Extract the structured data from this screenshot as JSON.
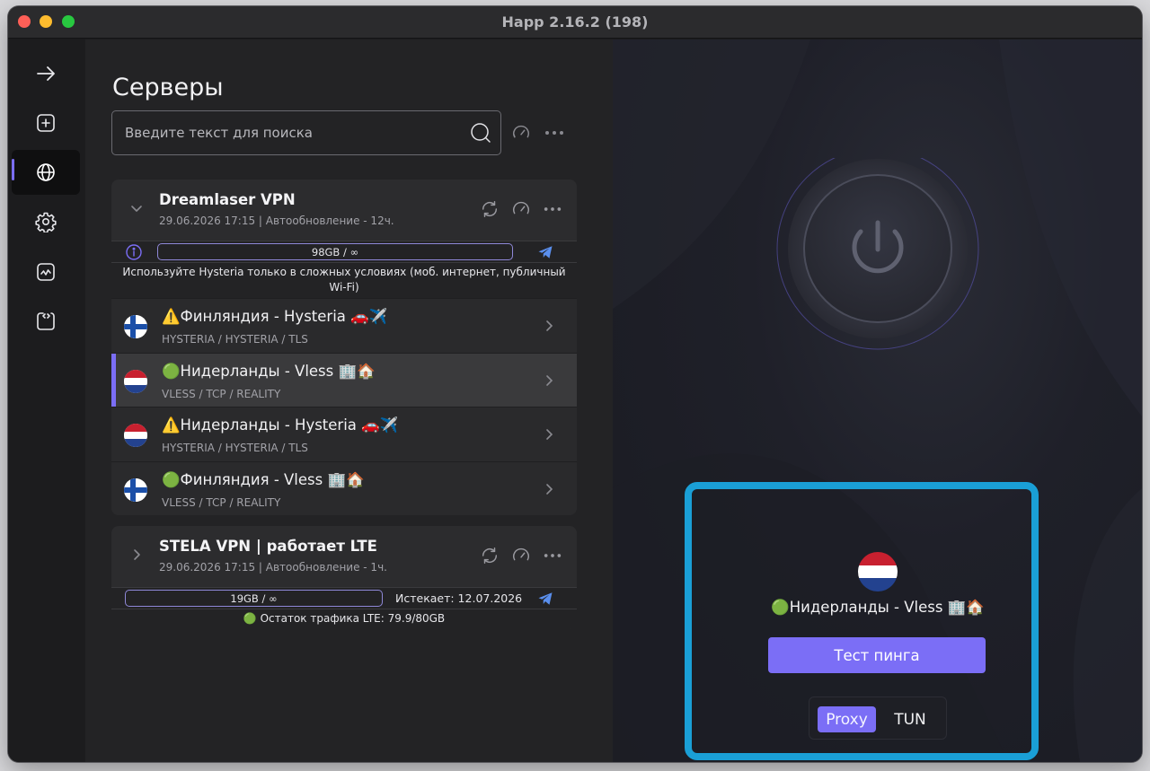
{
  "window": {
    "title": "Happ 2.16.2 (198)"
  },
  "sidebar": {
    "items": [
      {
        "name": "arrow-right-icon"
      },
      {
        "name": "add-square-icon"
      },
      {
        "name": "globe-icon",
        "active": true
      },
      {
        "name": "gear-icon"
      },
      {
        "name": "activity-chart-icon"
      },
      {
        "name": "code-bracket-icon"
      }
    ],
    "info_label": "i"
  },
  "servers": {
    "title": "Серверы",
    "search_placeholder": "Введите текст для поиска",
    "groups": [
      {
        "name": "Dreamlaser VPN",
        "subtitle": "29.06.2026 17:15 | Автообновление - 12ч.",
        "usage": "98GB / ∞",
        "note": "Используйте Hysteria только в сложных условиях (моб. интернет, публичный Wi-Fi)",
        "servers": [
          {
            "name": "⚠️Финляндия - Hysteria 🚗✈️",
            "protocol": "HYSTERIA / HYSTERIA / TLS",
            "flag": "finland-flag"
          },
          {
            "name": "🟢Нидерланды - Vless 🏢🏠",
            "protocol": "VLESS / TCP / REALITY",
            "flag": "netherlands-flag",
            "selected": true
          },
          {
            "name": "⚠️Нидерланды - Hysteria 🚗✈️",
            "protocol": "HYSTERIA / HYSTERIA / TLS",
            "flag": "netherlands-flag"
          },
          {
            "name": "🟢Финляндия - Vless 🏢🏠",
            "protocol": "VLESS / TCP / REALITY",
            "flag": "finland-flag"
          }
        ]
      },
      {
        "name": "STELA VPN | работает LTE",
        "subtitle": "29.06.2026 17:15 | Автообновление - 1ч.",
        "usage": "19GB / ∞",
        "expires": "Истекает: 12.07.2026",
        "note": "🟢 Остаток трафика LTE: 79.9/80GB"
      }
    ]
  },
  "connection": {
    "selected_server": "🟢Нидерланды - Vless 🏢🏠",
    "selected_flag": "netherlands-flag",
    "ping_button": "Тест пинга",
    "modes": {
      "active": "Proxy",
      "inactive": "TUN"
    }
  },
  "colors": {
    "accent": "#7b6ef6",
    "highlight": "#1a9fd6"
  }
}
